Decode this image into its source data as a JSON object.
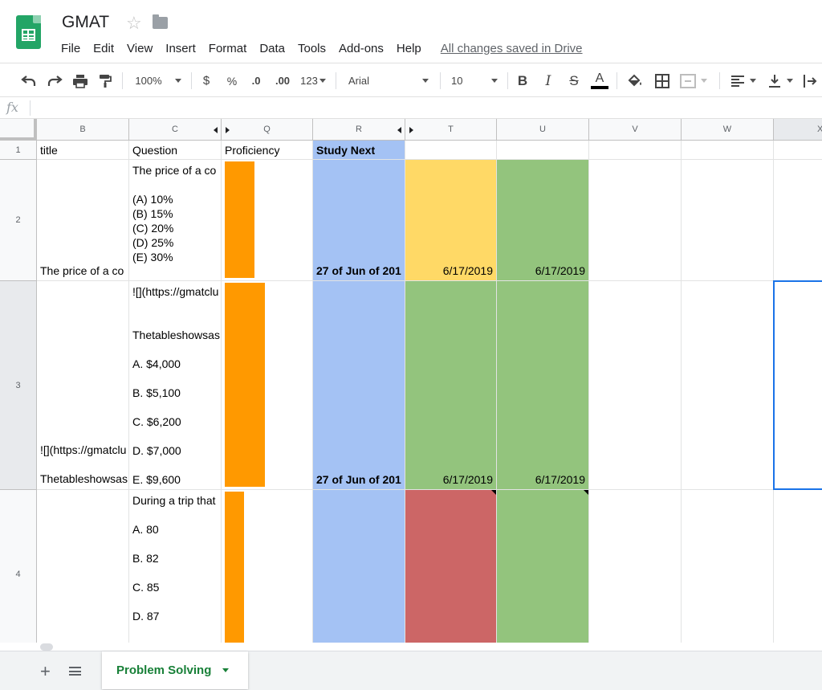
{
  "app": {
    "doc_title": "GMAT",
    "menu": [
      "File",
      "Edit",
      "View",
      "Insert",
      "Format",
      "Data",
      "Tools",
      "Add-ons",
      "Help"
    ],
    "save_status": "All changes saved in Drive"
  },
  "toolbar": {
    "zoom": "100%",
    "currency": "$",
    "percent": "%",
    "decimal_decrease": ".0",
    "decimal_increase": ".00",
    "more_formats": "123",
    "font": "Arial",
    "font_size": "10",
    "bold": "B",
    "italic": "I",
    "strike": "S",
    "text_color": "A"
  },
  "formula_bar": {
    "fx": "fx",
    "value": ""
  },
  "columns": [
    "B",
    "C",
    "Q",
    "R",
    "T",
    "U",
    "V",
    "W",
    "X"
  ],
  "rows": [
    "1",
    "2",
    "3",
    "4"
  ],
  "colors": {
    "study_next_bg": "#a4c2f4",
    "yellow": "#ffd966",
    "green": "#93c47d",
    "red": "#cc6666",
    "orange_bar": "#ff9900",
    "selection": "#1a73e8"
  },
  "header_row": {
    "title": "title",
    "question": "Question",
    "proficiency": "Proficiency",
    "study_next": "Study Next"
  },
  "row2": {
    "title": "The price of a co",
    "question_lines": [
      "The price of a co",
      "",
      "(A) 10%",
      "(B) 15%",
      "(C) 20%",
      "(D) 25%",
      "(E) 30%"
    ],
    "proficiency_level": 0.35,
    "study_next": "27 of Jun of 201",
    "t": "6/17/2019",
    "u": "6/17/2019"
  },
  "row3": {
    "title_lines": [
      "![](https://gmatclu",
      "",
      "Thetableshowsas"
    ],
    "question_lines": [
      "![](https://gmatclu",
      "",
      "",
      "Thetableshowsas",
      "",
      "A. $4,000",
      "",
      "B. $5,100",
      "",
      "C. $6,200",
      "",
      "D. $7,000",
      "",
      "E. $9,600"
    ],
    "proficiency_level": 0.47,
    "study_next": "27 of Jun of 201",
    "t": "6/17/2019",
    "u": "6/17/2019"
  },
  "row4": {
    "question_lines": [
      "During a trip that",
      "",
      "A. 80",
      "",
      "B. 82",
      "",
      "C. 85",
      "",
      "D. 87"
    ],
    "proficiency_level": 0.23
  },
  "sheet_tabs": [
    {
      "name": "Problem Solving",
      "active": true
    }
  ]
}
